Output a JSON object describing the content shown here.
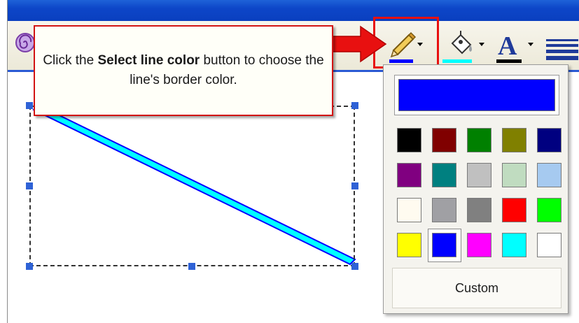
{
  "callout": {
    "text_before": "Click the ",
    "text_bold": "Select line color",
    "text_after": " button to choose the line's border color."
  },
  "toolbar": {
    "line_color_button": {
      "icon": "pencil-icon",
      "color_bar": "#0000ff"
    },
    "fill_color_button": {
      "icon": "paint-bucket-icon",
      "color_bar": "#00ffff"
    },
    "font_color_button": {
      "icon": "font-color-icon",
      "letter": "A",
      "color_bar": "#000000"
    },
    "line_style_button": {
      "icon": "line-style-icon"
    }
  },
  "palette": {
    "current_color": "#0000ff",
    "swatches": [
      "#000000",
      "#800000",
      "#008000",
      "#808000",
      "#000080",
      "#800080",
      "#008080",
      "#c0c0c0",
      "#c0dcc0",
      "#a6caf0",
      "#fffbf0",
      "#a0a0a4",
      "#808080",
      "#ff0000",
      "#00ff00",
      "#ffff00",
      "#0000ff",
      "#ff00ff",
      "#00ffff",
      "#ffffff"
    ],
    "selected_index": 16,
    "custom_label": "Custom"
  },
  "colors": {
    "highlight": "#e81010",
    "line_fill": "#00ffff",
    "line_border": "#0000ff",
    "title_bar": "#0d46c8"
  }
}
